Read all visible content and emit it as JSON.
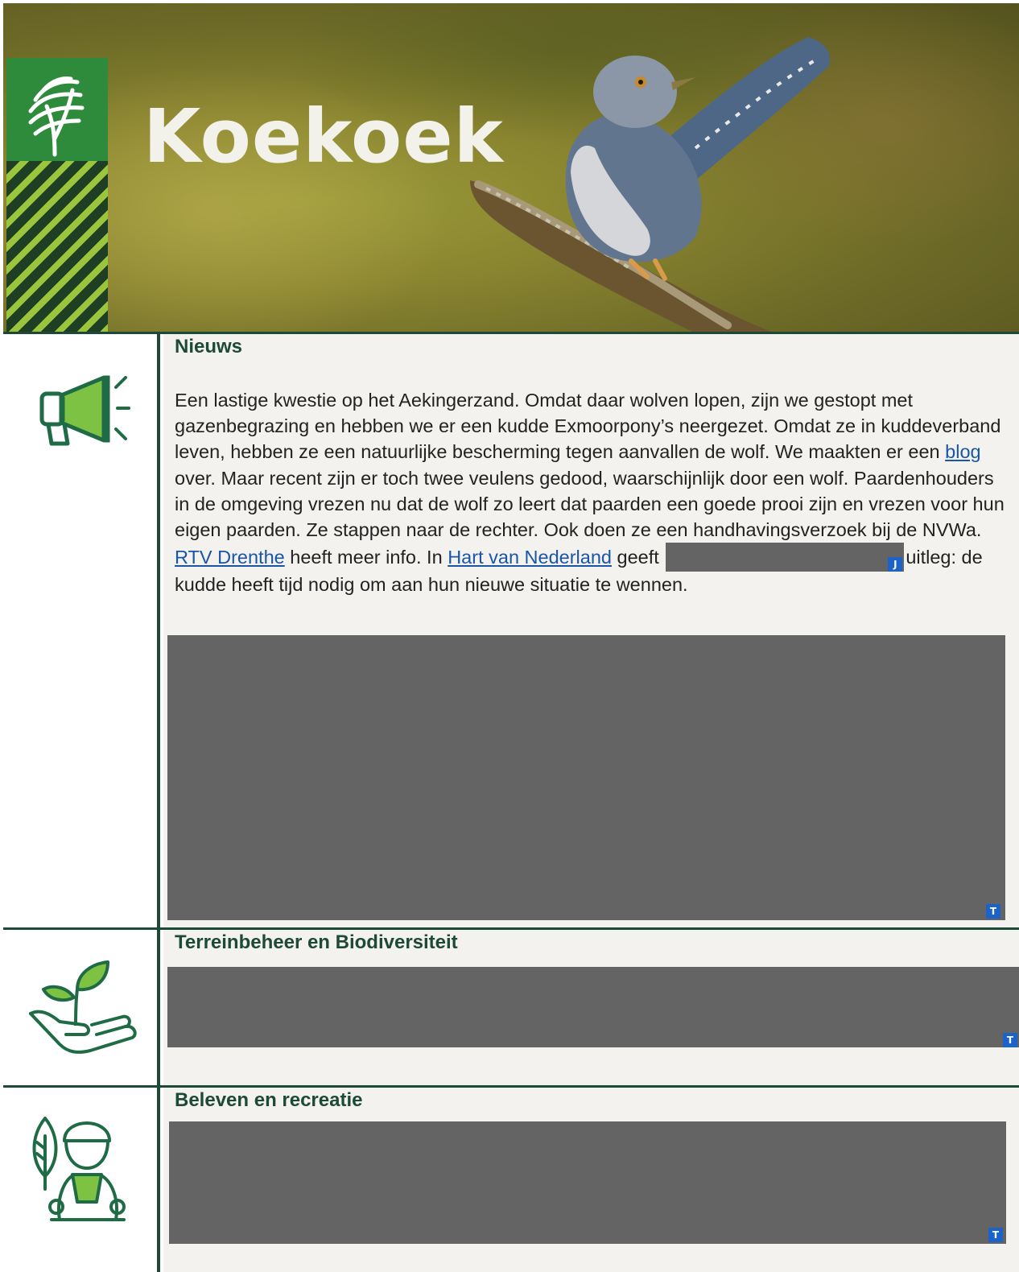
{
  "banner": {
    "title": "Koekoek"
  },
  "sections": [
    {
      "title": "Nieuws",
      "icon": "megaphone-icon",
      "paragraph": {
        "p1": "Een lastige kwestie op het Aekingerzand. Omdat daar wolven lopen, zijn we gestopt met gazenbegrazing en hebben we er een kudde Exmoorpony’s neergezet. Omdat ze in kuddeverband leven, hebben ze een natuurlijke bescherming tegen aanvallen de wolf. We maakten er een ",
        "link_blog": "blog",
        "p2": " over. Maar recent zijn er toch twee veulens gedood, waarschijnlijk  door een wolf. Paardenhouders in de omgeving vrezen nu dat de wolf zo leert dat paarden een goede prooi zijn en vrezen  voor hun eigen paarden. Ze stappen naar de rechter. Ook doen ze een handhavingsverzoek bij de NVWa. ",
        "link_rtv": "RTV Drenthe",
        "p3": " heeft meer info. In ",
        "link_hart": "Hart van Nederland",
        "p4": " geeft ",
        "p5": "uitleg: de kudde heeft tijd nodig om aan hun nieuwe situatie te wennen."
      },
      "redaction_tags": [
        "J",
        "T"
      ]
    },
    {
      "title": "Terreinbeheer en Biodiversiteit",
      "icon": "plant-in-hand-icon",
      "redaction_tags": [
        "T"
      ]
    },
    {
      "title": "Beleven en recreatie",
      "icon": "ranger-with-leaf-icon",
      "redaction_tags": [
        "T"
      ]
    }
  ],
  "colors": {
    "dark_green": "#1d4a36",
    "icon_green": "#1f6b45",
    "accent_green": "#7dc242",
    "link_blue": "#1a56a6",
    "redaction_gray": "#646464",
    "tag_blue": "#1c63c9"
  }
}
